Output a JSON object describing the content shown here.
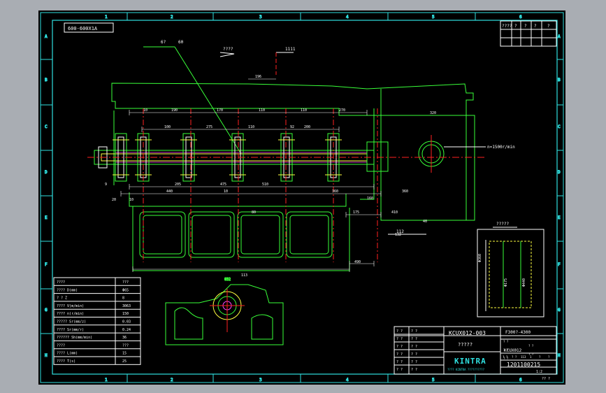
{
  "drawing": {
    "colors": {
      "background": "#000000",
      "frame": "#2fe0e0",
      "part": "#39ff39",
      "annotation": "#ffffff",
      "centerline": "#ff2020",
      "leader": "#ffff40",
      "tool": "#ff40ff",
      "page": "#a9adb3"
    },
    "column_labels": [
      "1",
      "2",
      "3",
      "4",
      "5",
      "6"
    ],
    "row_labels": [
      "A",
      "B",
      "C",
      "D",
      "E",
      "F",
      "G",
      "H"
    ],
    "corner_stamp": "600-600X1A",
    "top_notes": [
      "6?",
      "60",
      "????",
      "1111"
    ],
    "speed_note": "n=1500r/min",
    "dimensions": [
      "10",
      "190",
      "170",
      "110",
      "110",
      "270",
      "196",
      "92",
      "100",
      "275",
      "110",
      "200",
      "205",
      "475",
      "510",
      "113",
      "490",
      "132",
      "40",
      "175",
      "360",
      "440",
      "320",
      "360",
      "410",
      "160",
      "80",
      "10",
      "9",
      "10",
      "20"
    ],
    "section_label": "?????",
    "revision_table": {
      "rows": [
        [
          "????",
          "?",
          "?",
          "?",
          "?"
        ],
        [
          "",
          "",
          "",
          "",
          ""
        ],
        [
          "",
          "",
          "",
          "",
          ""
        ]
      ]
    },
    "params_table": {
      "rows": [
        [
          "????",
          "???"
        ],
        [
          "???? D(mm)",
          "Φ65"
        ],
        [
          "? ? Z",
          "8"
        ],
        [
          "???? V(m/min)",
          "3063"
        ],
        [
          "???? n(r/min)",
          "150"
        ],
        [
          "????? Sr(mm/z)",
          "0.03"
        ],
        [
          "???? Sr(mm/r)",
          "0.24"
        ],
        [
          "?????? Sh(mm/min)",
          "36"
        ],
        [
          "????",
          "???"
        ],
        [
          "???? L(mm)",
          "15"
        ],
        [
          "???? T(s)",
          "25"
        ]
      ]
    },
    "title_block": {
      "drawing_no": "KCUX012-003",
      "name": "?????",
      "material": "F300?-4300",
      "company": "KINTRA",
      "company_sub": "???? KINTRA ??????????",
      "code": "1201100215",
      "subcode": "KCUX012",
      "page": "?? ?",
      "small_rows": [
        "? ?",
        "? ?",
        "? ?",
        "? ?",
        "? ?",
        "? ?"
      ],
      "mid_rows": [
        "? ?",
        "? ?",
        "? ?",
        "? ?",
        "? ?"
      ],
      "scale_row": [
        "? ?",
        "? ?",
        "113",
        "1",
        "?",
        "?"
      ],
      "sheet_count": "1:2"
    }
  }
}
